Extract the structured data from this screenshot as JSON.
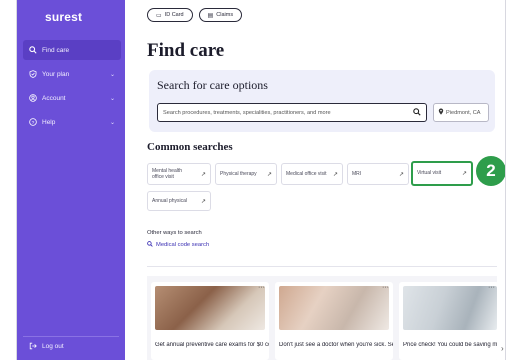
{
  "sidebar": {
    "logo": "surest",
    "items": [
      {
        "label": "Find care",
        "icon": "search-icon",
        "active": true,
        "chevron": ""
      },
      {
        "label": "Your plan",
        "icon": "shield-icon",
        "active": false,
        "chevron": "⌄"
      },
      {
        "label": "Account",
        "icon": "user-icon",
        "active": false,
        "chevron": "⌄"
      },
      {
        "label": "Help",
        "icon": "help-icon",
        "active": false,
        "chevron": "⌄"
      }
    ],
    "logout": "Log out"
  },
  "topbar": {
    "id_card": "ID Card",
    "claims": "Claims"
  },
  "page": {
    "title": "Find care"
  },
  "search": {
    "heading": "Search for care options",
    "placeholder": "Search procedures, treatments, specialities, practitioners, and more",
    "location": "Piedmont, CA"
  },
  "common": {
    "heading": "Common searches",
    "chips": [
      {
        "label": "Mental health office visit"
      },
      {
        "label": "Physical therapy"
      },
      {
        "label": "Medical office visit"
      },
      {
        "label": "MRI"
      },
      {
        "label": "Virtual visit"
      },
      {
        "label": "Annual physical"
      }
    ],
    "arrow": "↗"
  },
  "annotation": {
    "step": "2",
    "color": "#2e9d4b"
  },
  "other": {
    "heading": "Other ways to search",
    "code_search": "Medical code search"
  },
  "cards": [
    {
      "text": "Get annual preventive care exams for $0 copay"
    },
    {
      "text": "Don't just see a doctor when you're sick. See a doctor to help"
    },
    {
      "text": "Price check! You could be saving money at doctor's appoint..."
    }
  ],
  "colors": {
    "brand": "#6b4fd8",
    "highlight": "#2e9d4b"
  }
}
